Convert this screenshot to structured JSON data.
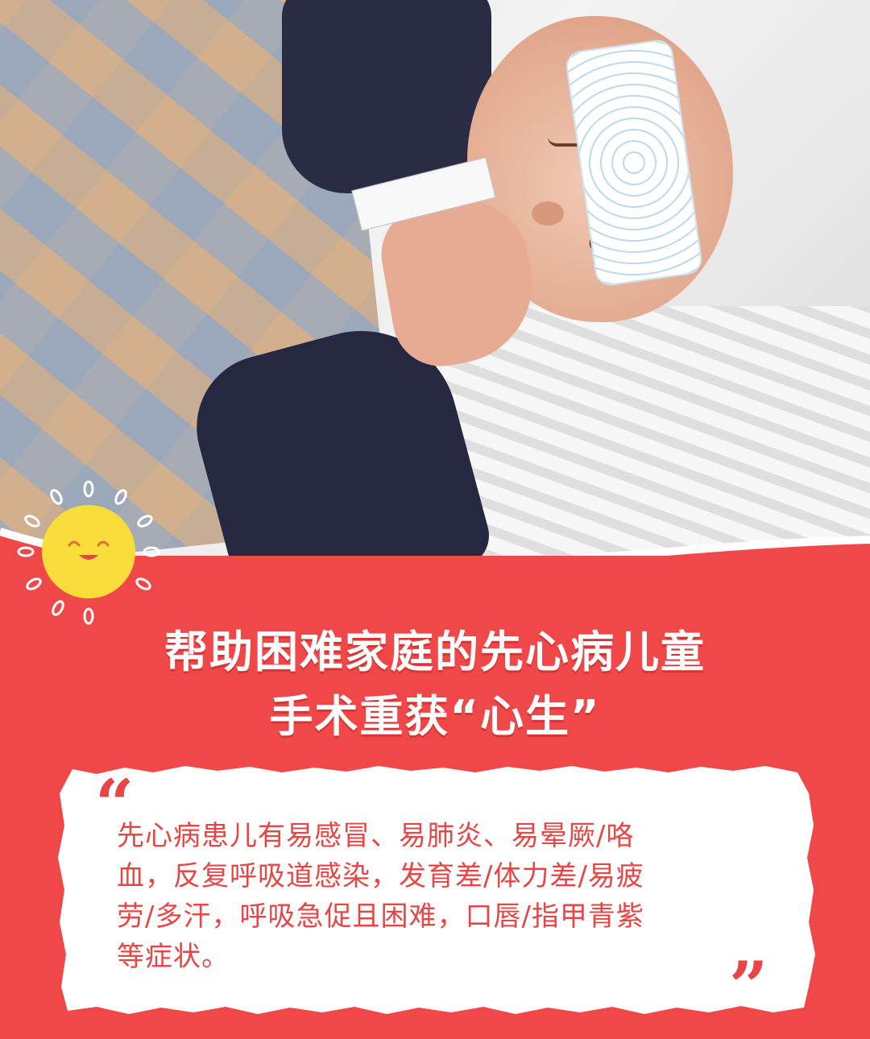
{
  "photo": {
    "subject": "baby-sleeping-photo"
  },
  "headline": {
    "line1": "帮助困难家庭的先心病儿童",
    "line2": "手术重获“心生”"
  },
  "quote": {
    "open_mark": "“",
    "close_mark": "”",
    "lines": [
      "先心病患儿有易感冒、易肺炎、易晕厥/咯",
      "血，反复呼吸道感染，发育差/体力差/易疲",
      "劳/多汗，呼吸急促且困难，口唇/指甲青紫",
      "等症状。"
    ]
  },
  "colors": {
    "background_red": "#f04848",
    "sun_yellow": "#f7dc3a",
    "text_white": "#ffffff",
    "quote_red": "#e84545",
    "card_white": "#ffffff"
  },
  "icons": {
    "sun": "smiling-sun-icon"
  }
}
